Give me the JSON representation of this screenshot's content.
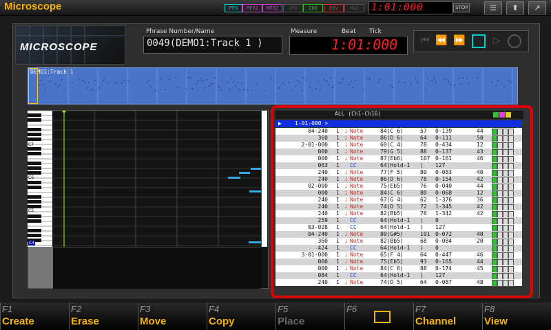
{
  "app": {
    "title": "Microscope",
    "logo": "MICROSCOPE"
  },
  "fx_buttons": [
    {
      "label": "PFX",
      "color": "#00d0d0"
    },
    {
      "label": "MFX1",
      "color": "#d040d0"
    },
    {
      "label": "MFX2",
      "color": "#d040d0"
    },
    {
      "label": "IFX",
      "color": "#555555"
    },
    {
      "label": "CHO",
      "color": "#20c020"
    },
    {
      "label": "REV",
      "color": "#e03030"
    },
    {
      "label": "MAS",
      "color": "#555555"
    }
  ],
  "clock": {
    "time": "1:01:000",
    "status": "STOP"
  },
  "phrase": {
    "label": "Phrase Number/Name",
    "value": "0049(DEMO1:Track 1 )"
  },
  "position": {
    "measure_label": "Measure",
    "beat_label": "Beat",
    "tick_label": "Tick",
    "value": "1:01:000"
  },
  "overview": {
    "label": "DEMO1:Track 1"
  },
  "piano": {
    "octave_labels": [
      "C7",
      "C6",
      "C5",
      "C4"
    ]
  },
  "list": {
    "title": "ALL (Ch1-Ch16)",
    "current_position": "1-01-000 >",
    "events": [
      {
        "pos": "04-240",
        "ch": "1",
        "type": "Note",
        "kind": "note",
        "data": "84(C 6)",
        "vel": "57",
        "len": "0-139",
        "extra": "44"
      },
      {
        "pos": "360",
        "ch": "1",
        "type": "Note",
        "kind": "note",
        "data": "86(D 6)",
        "vel": "64",
        "len": "0-111",
        "extra": "50"
      },
      {
        "pos": "2-01-000",
        "ch": "1",
        "type": "Note",
        "kind": "note",
        "data": "60(C 4)",
        "vel": "78",
        "len": "0-434",
        "extra": "12"
      },
      {
        "pos": "000",
        "ch": "1",
        "type": "Note",
        "kind": "note",
        "data": "79(G 5)",
        "vel": "88",
        "len": "0-137",
        "extra": "43"
      },
      {
        "pos": "000",
        "ch": "1",
        "type": "Note",
        "kind": "note",
        "data": "87(Eb6)",
        "vel": "107",
        "len": "0-161",
        "extra": "46"
      },
      {
        "pos": "063",
        "ch": "1",
        "type": "CC",
        "kind": "cc",
        "data": "64(Hold-1",
        "vel": ")",
        "len": "127",
        "extra": ""
      },
      {
        "pos": "240",
        "ch": "1",
        "type": "Note",
        "kind": "note",
        "data": "77(F 5)",
        "vel": "80",
        "len": "0-083",
        "extra": "40"
      },
      {
        "pos": "240",
        "ch": "1",
        "type": "Note",
        "kind": "note",
        "data": "86(D 6)",
        "vel": "78",
        "len": "0-154",
        "extra": "42"
      },
      {
        "pos": "02-000",
        "ch": "1",
        "type": "Note",
        "kind": "note",
        "data": "75(Eb5)",
        "vel": "76",
        "len": "0-040",
        "extra": "44"
      },
      {
        "pos": "000",
        "ch": "1",
        "type": "Note",
        "kind": "note",
        "data": "84(C 6)",
        "vel": "80",
        "len": "0-068",
        "extra": "12"
      },
      {
        "pos": "240",
        "ch": "1",
        "type": "Note",
        "kind": "note",
        "data": "67(G 4)",
        "vel": "62",
        "len": "1-376",
        "extra": "36"
      },
      {
        "pos": "240",
        "ch": "1",
        "type": "Note",
        "kind": "note",
        "data": "74(D 5)",
        "vel": "72",
        "len": "1-345",
        "extra": "42"
      },
      {
        "pos": "240",
        "ch": "1",
        "type": "Note",
        "kind": "note",
        "data": "82(Bb5)",
        "vel": "76",
        "len": "1-342",
        "extra": "42"
      },
      {
        "pos": "259",
        "ch": "1",
        "type": "CC",
        "kind": "cc",
        "data": "64(Hold-1",
        "vel": ")",
        "len": "0",
        "extra": ""
      },
      {
        "pos": "03-028",
        "ch": "1",
        "type": "CC",
        "kind": "cc",
        "data": "64(Hold-1",
        "vel": ")",
        "len": "127",
        "extra": ""
      },
      {
        "pos": "04-240",
        "ch": "1",
        "type": "Note",
        "kind": "note",
        "data": "80(G#5)",
        "vel": "101",
        "len": "0-072",
        "extra": "40"
      },
      {
        "pos": "360",
        "ch": "1",
        "type": "Note",
        "kind": "note",
        "data": "82(Bb5)",
        "vel": "68",
        "len": "0-084",
        "extra": "20"
      },
      {
        "pos": "424",
        "ch": "1",
        "type": "CC",
        "kind": "cc",
        "data": "64(Hold-1",
        "vel": ")",
        "len": "0",
        "extra": ""
      },
      {
        "pos": "3-01-000",
        "ch": "1",
        "type": "Note",
        "kind": "note",
        "data": "65(F 4)",
        "vel": "64",
        "len": "0-447",
        "extra": "46"
      },
      {
        "pos": "000",
        "ch": "1",
        "type": "Note",
        "kind": "note",
        "data": "75(Eb5)",
        "vel": "93",
        "len": "0-165",
        "extra": "44"
      },
      {
        "pos": "000",
        "ch": "1",
        "type": "Note",
        "kind": "note",
        "data": "84(C 6)",
        "vel": "88",
        "len": "0-174",
        "extra": "45"
      },
      {
        "pos": "084",
        "ch": "1",
        "type": "CC",
        "kind": "cc",
        "data": "64(Hold-1",
        "vel": ")",
        "len": "127",
        "extra": ""
      },
      {
        "pos": "240",
        "ch": "1",
        "type": "Note",
        "kind": "note",
        "data": "74(D 5)",
        "vel": "64",
        "len": "0-087",
        "extra": "48"
      }
    ]
  },
  "fkeys": [
    {
      "num": "F1",
      "label": "Create",
      "enabled": true
    },
    {
      "num": "F2",
      "label": "Erase",
      "enabled": true
    },
    {
      "num": "F3",
      "label": "Move",
      "enabled": true
    },
    {
      "num": "F4",
      "label": "Copy",
      "enabled": true
    },
    {
      "num": "F5",
      "label": "Place",
      "enabled": false
    },
    {
      "num": "F6",
      "label": "",
      "enabled": true
    },
    {
      "num": "F7",
      "label": "Channel",
      "enabled": true
    },
    {
      "num": "F8",
      "label": "View",
      "enabled": true
    }
  ]
}
